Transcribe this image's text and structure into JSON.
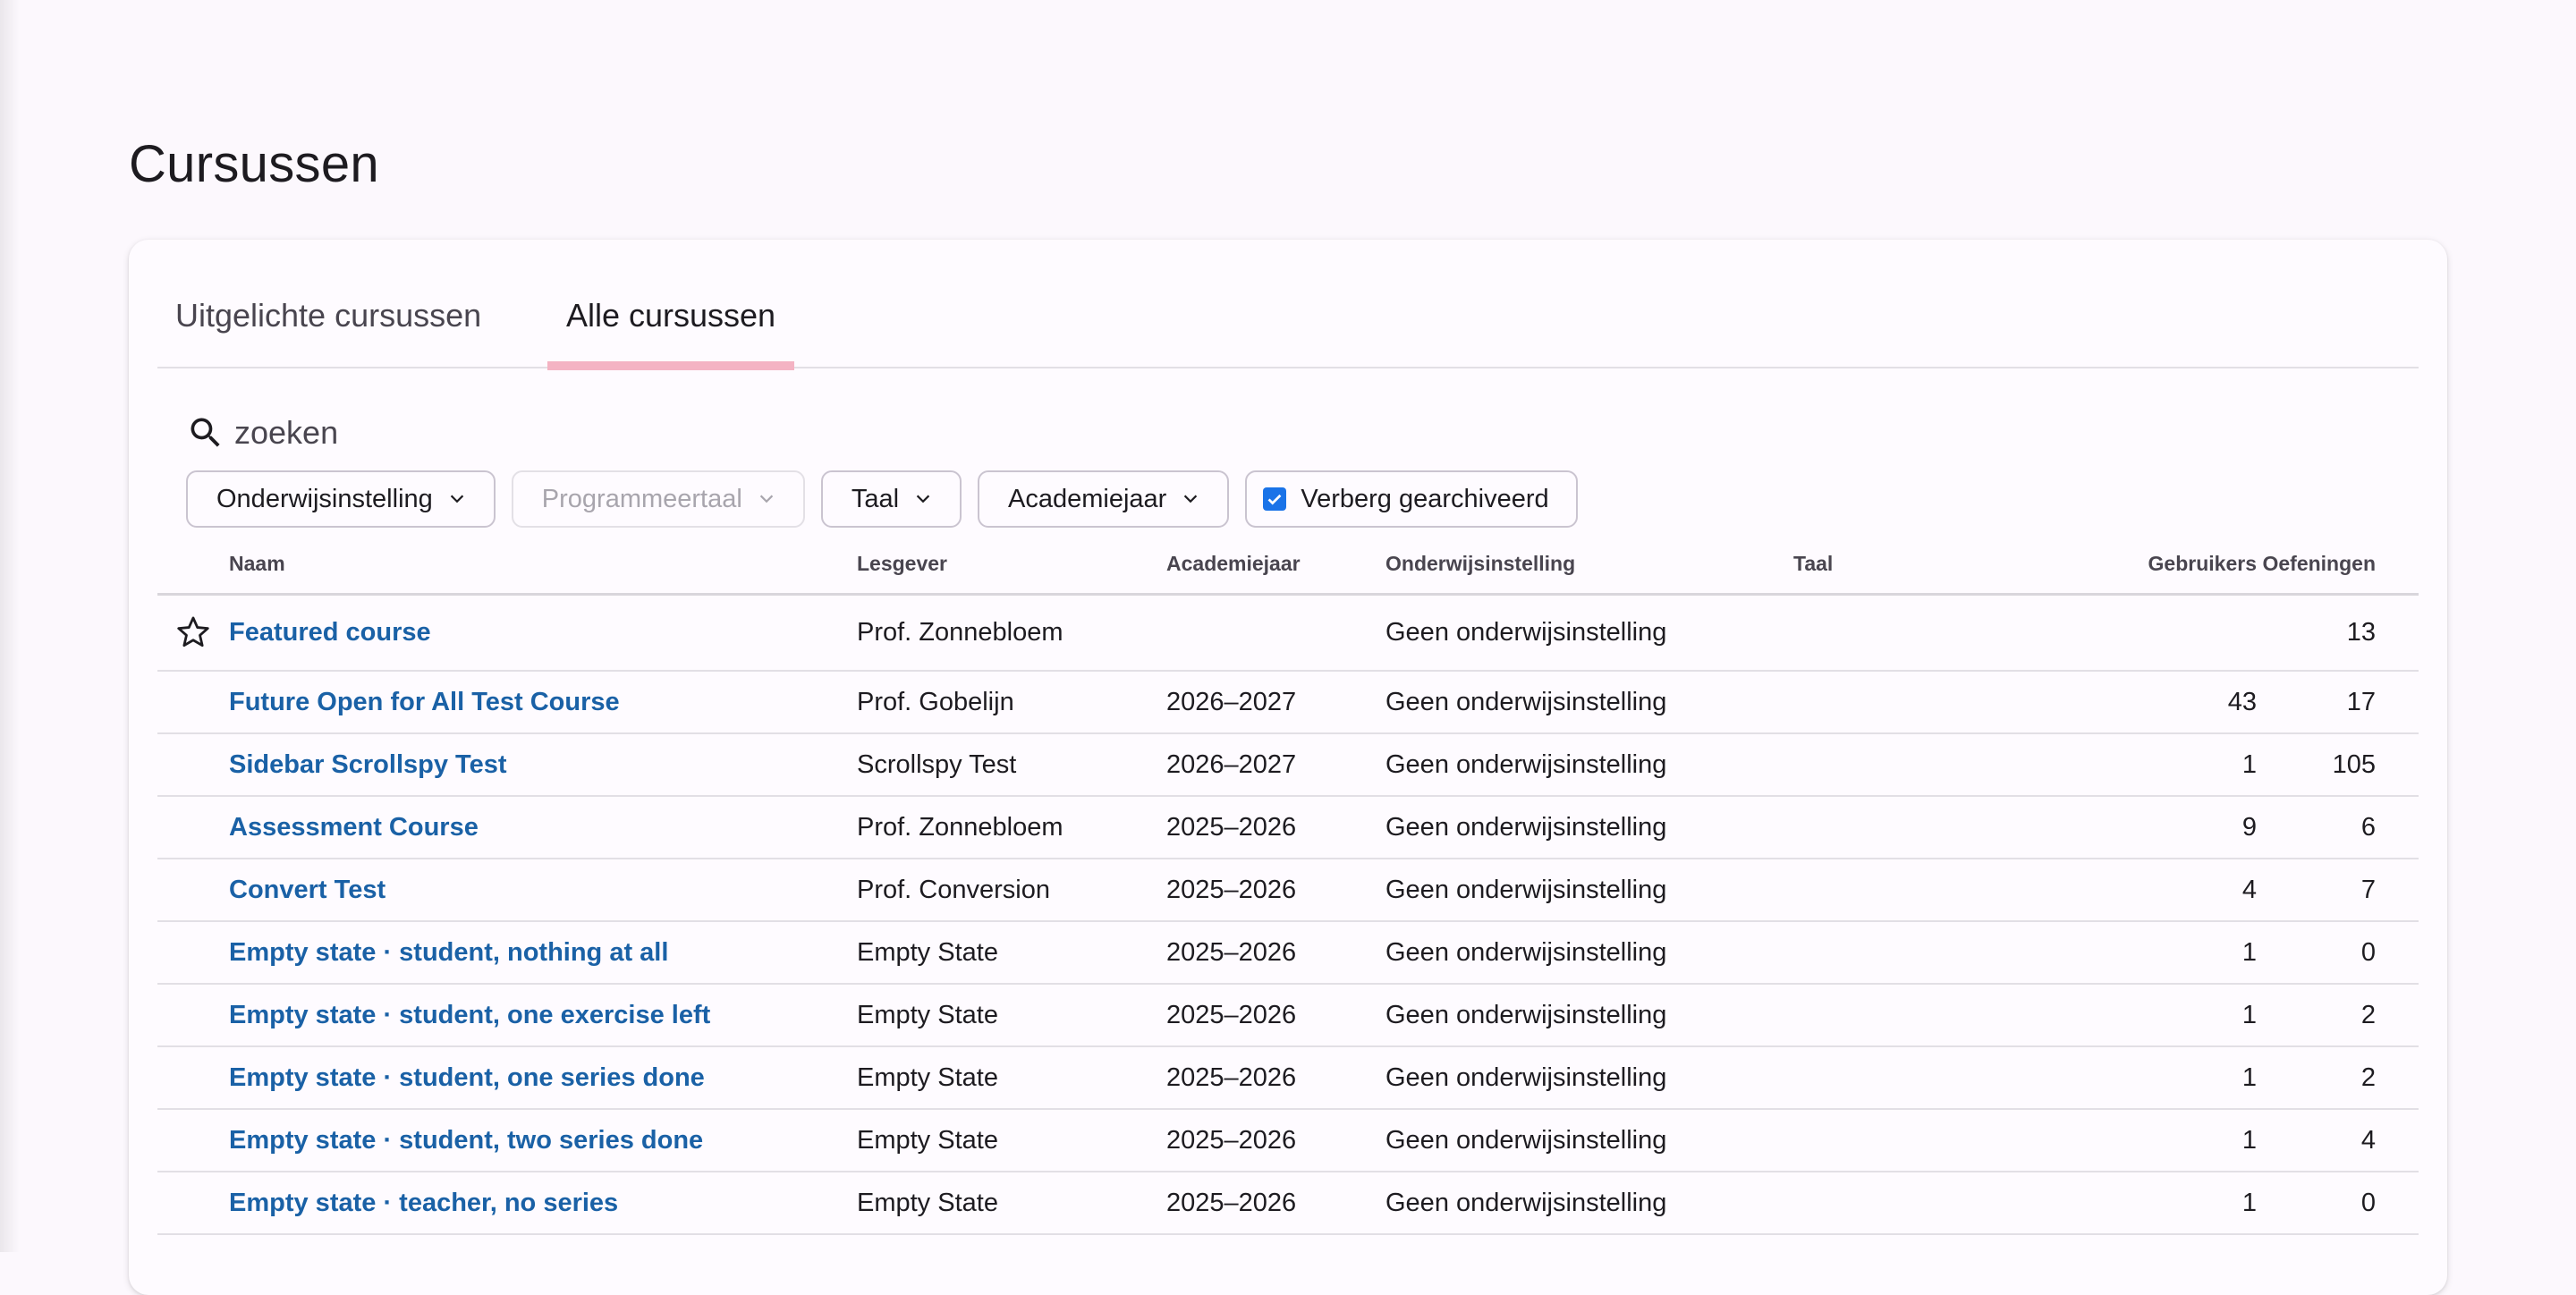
{
  "page": {
    "title": "Cursussen"
  },
  "tabs": [
    {
      "label": "Uitgelichte cursussen",
      "active": false
    },
    {
      "label": "Alle cursussen",
      "active": true
    }
  ],
  "search": {
    "placeholder": "zoeken",
    "value": ""
  },
  "filters": {
    "institution": "Onderwijsinstelling",
    "programming_language": "Programmeertaal",
    "language": "Taal",
    "academic_year": "Academiejaar",
    "hide_archived": {
      "label": "Verberg gearchiveerd",
      "checked": true
    }
  },
  "table": {
    "columns": {
      "name": "Naam",
      "teacher": "Lesgever",
      "year": "Academiejaar",
      "institution": "Onderwijsinstelling",
      "language": "Taal",
      "users": "Gebruikers",
      "exercises": "Oefeningen"
    },
    "rows": [
      {
        "starred": true,
        "name": "Featured course",
        "teacher": "Prof. Zonnebloem",
        "year": "",
        "institution": "Geen onderwijsinstelling",
        "language": "",
        "users": "",
        "exercises": "13"
      },
      {
        "starred": false,
        "name": "Future Open for All Test Course",
        "teacher": "Prof. Gobelijn",
        "year": "2026–2027",
        "institution": "Geen onderwijsinstelling",
        "language": "",
        "users": "43",
        "exercises": "17"
      },
      {
        "starred": false,
        "name": "Sidebar Scrollspy Test",
        "teacher": "Scrollspy Test",
        "year": "2026–2027",
        "institution": "Geen onderwijsinstelling",
        "language": "",
        "users": "1",
        "exercises": "105"
      },
      {
        "starred": false,
        "name": "Assessment Course",
        "teacher": "Prof. Zonnebloem",
        "year": "2025–2026",
        "institution": "Geen onderwijsinstelling",
        "language": "",
        "users": "9",
        "exercises": "6"
      },
      {
        "starred": false,
        "name": "Convert Test",
        "teacher": "Prof. Conversion",
        "year": "2025–2026",
        "institution": "Geen onderwijsinstelling",
        "language": "",
        "users": "4",
        "exercises": "7"
      },
      {
        "starred": false,
        "name": "Empty state · student, nothing at all",
        "teacher": "Empty State",
        "year": "2025–2026",
        "institution": "Geen onderwijsinstelling",
        "language": "",
        "users": "1",
        "exercises": "0"
      },
      {
        "starred": false,
        "name": "Empty state · student, one exercise left",
        "teacher": "Empty State",
        "year": "2025–2026",
        "institution": "Geen onderwijsinstelling",
        "language": "",
        "users": "1",
        "exercises": "2"
      },
      {
        "starred": false,
        "name": "Empty state · student, one series done",
        "teacher": "Empty State",
        "year": "2025–2026",
        "institution": "Geen onderwijsinstelling",
        "language": "",
        "users": "1",
        "exercises": "2"
      },
      {
        "starred": false,
        "name": "Empty state · student, two series done",
        "teacher": "Empty State",
        "year": "2025–2026",
        "institution": "Geen onderwijsinstelling",
        "language": "",
        "users": "1",
        "exercises": "4"
      },
      {
        "starred": false,
        "name": "Empty state · teacher, no series",
        "teacher": "Empty State",
        "year": "2025–2026",
        "institution": "Geen onderwijsinstelling",
        "language": "",
        "users": "1",
        "exercises": "0"
      }
    ]
  },
  "colors": {
    "link": "#1a61a6",
    "tab_indicator": "#f4b3c3",
    "checkbox": "#1a73e8"
  }
}
